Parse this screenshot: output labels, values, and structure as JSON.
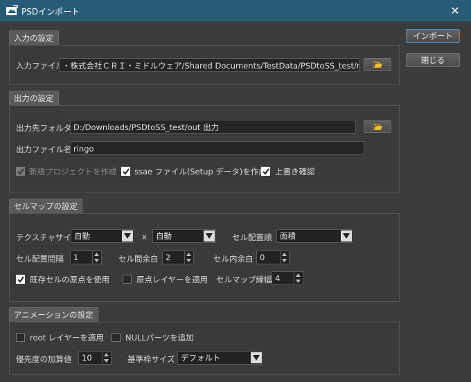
{
  "window": {
    "title": "PSDインポート",
    "close_glyph": "✕"
  },
  "actions": {
    "import_label": "インポート",
    "close_label": "閉じる"
  },
  "input_section": {
    "header": "入力の設定",
    "file_label": "入力ファイル",
    "file_value": "・株式会社ＣＲＩ・ミドルウェア/Shared Documents/TestData/PSDtoSS_test/ringo.psd"
  },
  "output_section": {
    "header": "出力の設定",
    "folder_label": "出力先フォルダ",
    "folder_value": "D:/Downloads/PSDtoSS_test/out 出力",
    "filename_label": "出力ファイル名",
    "filename_value": "ringo",
    "new_project_label": "新規プロジェクトを作成",
    "new_project_checked": true,
    "ssae_label": "ssae ファイル(Setup データ)を作成",
    "ssae_checked": true,
    "overwrite_label": "上書き確認",
    "overwrite_checked": true
  },
  "cellmap_section": {
    "header": "セルマップの設定",
    "texture_size_label": "テクスチャサイズ",
    "texture_w": "自動",
    "x_sep": "x",
    "texture_h": "自動",
    "order_label": "セル配置順",
    "order_value": "面積",
    "spacing_label": "セル配置間隔",
    "spacing_value": "1",
    "margin_label": "セル間余白",
    "margin_value": "2",
    "inner_label": "セル内余白",
    "inner_value": "0",
    "use_origin_label": "既存セルの原点を使用",
    "use_origin_checked": true,
    "origin_layer_label": "原点レイヤーを適用",
    "origin_layer_checked": false,
    "border_label": "セルマップ縁幅",
    "border_value": "4"
  },
  "anim_section": {
    "header": "アニメーションの設定",
    "root_layer_label": "root レイヤーを適用",
    "root_layer_checked": false,
    "null_parts_label": "NULLパーツを追加",
    "null_parts_checked": false,
    "priority_label": "優先度の加算値",
    "priority_value": "10",
    "frame_label": "基準枠サイズ",
    "frame_value": "デフォルト"
  },
  "icons": [
    "app-icon",
    "close-icon",
    "folder-icon",
    "dropdown-arrow-icon",
    "spin-up-icon",
    "spin-down-icon",
    "checkmark-icon"
  ],
  "colors": {
    "titlebar": "#275b78",
    "background": "#3c3c3c",
    "primary_border": "#4a90c8"
  }
}
